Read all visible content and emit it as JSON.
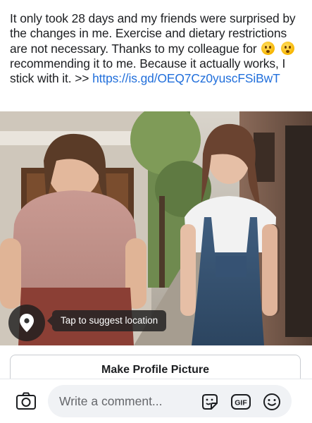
{
  "post": {
    "text_part1": "It only took 28 days and my friends were surprised by the changes in me. Exercise and dietary restrictions are not necessary. Thanks to my colleague for ",
    "text_part2": " recommending it to me. Because it actually works, I stick with it. >> ",
    "link": "https://is.gd/OEQ7Cz0yuscFSiBwT",
    "emojis": [
      "shushing-face-emoji",
      "hushed-face-emoji"
    ]
  },
  "photo": {
    "location_tooltip": "Tap to suggest location",
    "location_icon": "map-pin-icon"
  },
  "actions": {
    "make_profile_picture": "Make Profile Picture"
  },
  "comment_bar": {
    "placeholder": "Write a comment...",
    "gif_label": "GIF",
    "icons": [
      "camera-icon",
      "sticker-icon",
      "gif-icon",
      "emoji-icon"
    ]
  },
  "colors": {
    "link": "#216fdb",
    "text": "#1c1e21",
    "placeholder": "#65676b",
    "input_bg": "#f0f2f5"
  }
}
